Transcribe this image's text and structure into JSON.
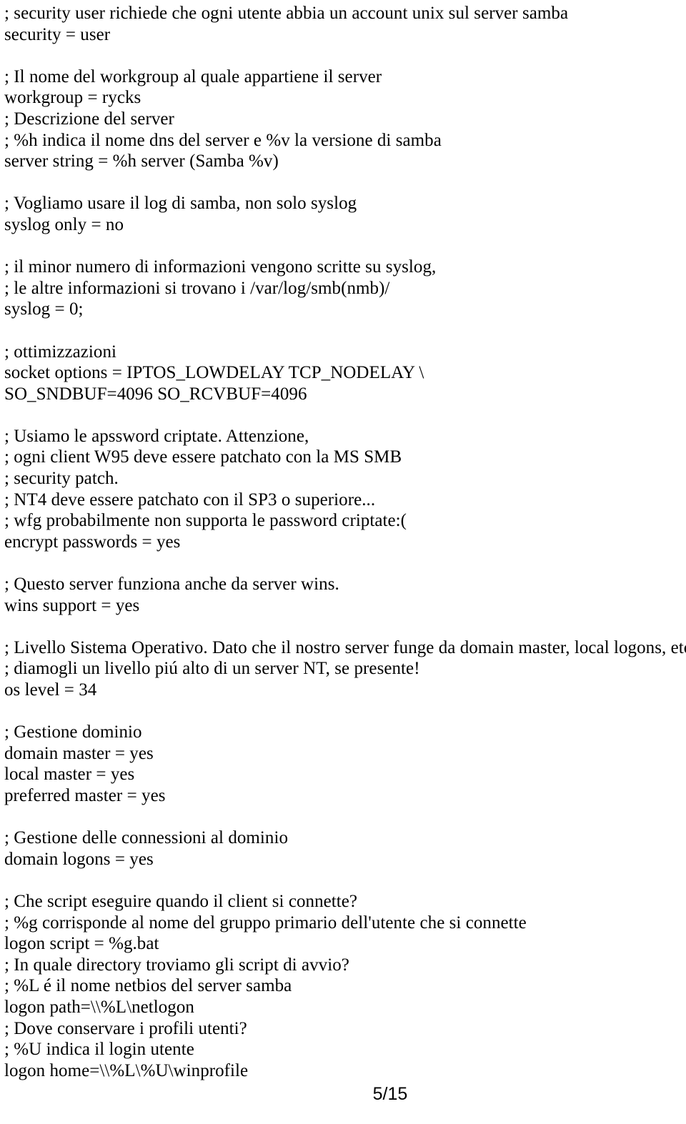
{
  "document": {
    "page_number": "5/15",
    "lines": [
      "; security user richiede che ogni utente abbia un account unix sul server samba",
      "security = user",
      "",
      "; Il nome del workgroup al quale appartiene il server",
      "workgroup = rycks",
      "; Descrizione del server",
      "; %h indica il nome dns del server e %v la versione di samba",
      "server string = %h server (Samba %v)",
      "",
      "; Vogliamo usare il log di samba, non solo syslog",
      "syslog only = no",
      "",
      "; il minor numero di informazioni vengono scritte su syslog,",
      "; le altre informazioni si trovano i /var/log/smb(nmb)/",
      "syslog = 0;",
      "",
      "; ottimizzazioni",
      "socket options = IPTOS_LOWDELAY TCP_NODELAY \\",
      "SO_SNDBUF=4096 SO_RCVBUF=4096",
      "",
      "; Usiamo le apssword criptate. Attenzione,",
      "; ogni client W95 deve essere patchato con la MS SMB",
      "; security patch.",
      "; NT4 deve essere patchato con il SP3 o superiore...",
      "; wfg probabilmente non supporta le password criptate:(",
      "encrypt passwords = yes",
      "",
      "; Questo server funziona anche da server wins.",
      "wins support = yes",
      "",
      "; Livello Sistema Operativo. Dato che il nostro server funge da domain master, local logons, etc...",
      "; diamogli un livello piú alto di un server NT, se presente!",
      "os level = 34",
      "",
      "; Gestione dominio",
      "domain master = yes",
      "local master = yes",
      "preferred master = yes",
      "",
      "; Gestione delle connessioni al dominio",
      "domain logons = yes",
      "",
      "; Che script eseguire quando il client si connette?",
      "; %g corrisponde al nome del gruppo primario dell'utente che si connette",
      "logon script = %g.bat",
      "; In quale directory troviamo gli script di avvio?",
      "; %L é il nome netbios del server samba",
      "logon path=\\\\%L\\netlogon",
      "; Dove conservare i profili utenti?",
      "; %U indica il login utente",
      "logon home=\\\\%L\\%U\\winprofile"
    ]
  }
}
